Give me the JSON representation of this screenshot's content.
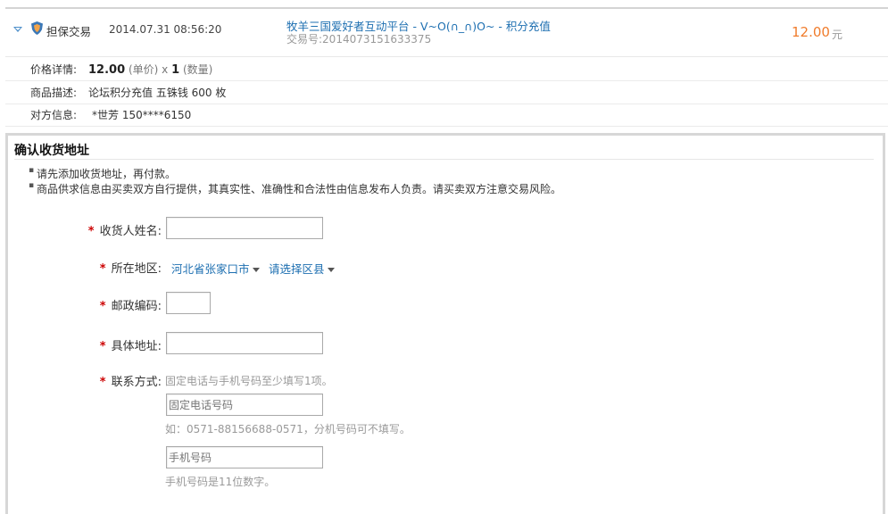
{
  "trade": {
    "type_label": "担保交易",
    "time": "2014.07.31 08:56:20",
    "title": "牧羊三国爱好者互动平台 - V~O(∩_∩)O~ - 积分充值",
    "trade_no_label": "交易号:",
    "trade_no": "2014073151633375",
    "amount": "12.00",
    "amount_unit": "元"
  },
  "details": {
    "price_label": "价格详情:",
    "price": "12.00",
    "price_unit_note": "(单价) x",
    "quantity": "1",
    "quantity_note": "(数量)",
    "desc_label": "商品描述:",
    "desc": "论坛积分充值 五铢钱 600 枚",
    "party_label": "对方信息:",
    "party": "*世芳 150****6150"
  },
  "address": {
    "title": "确认收货地址",
    "notices": [
      "请先添加收货地址，再付款。",
      "商品供求信息由买卖双方自行提供，其真实性、准确性和合法性由信息发布人负责。请买卖双方注意交易风险。"
    ],
    "required_mark": "*",
    "name_label": "收货人姓名:",
    "region_label": "所在地区:",
    "province_city": "河北省张家口市",
    "district": "请选择区县",
    "zip_label": "邮政编码:",
    "street_label": "具体地址:",
    "contact_label": "联系方式:",
    "contact_hint": "固定电话与手机号码至少填写1项。",
    "phone_placeholder": "固定电话号码",
    "phone_hint": "如：0571-88156688-0571，分机号码可不填写。",
    "mobile_placeholder": "手机号码",
    "mobile_hint": "手机号码是11位数字。"
  },
  "colors": {
    "link": "#1d6fb1",
    "amount": "#f07c2c",
    "required": "#cc0000"
  }
}
